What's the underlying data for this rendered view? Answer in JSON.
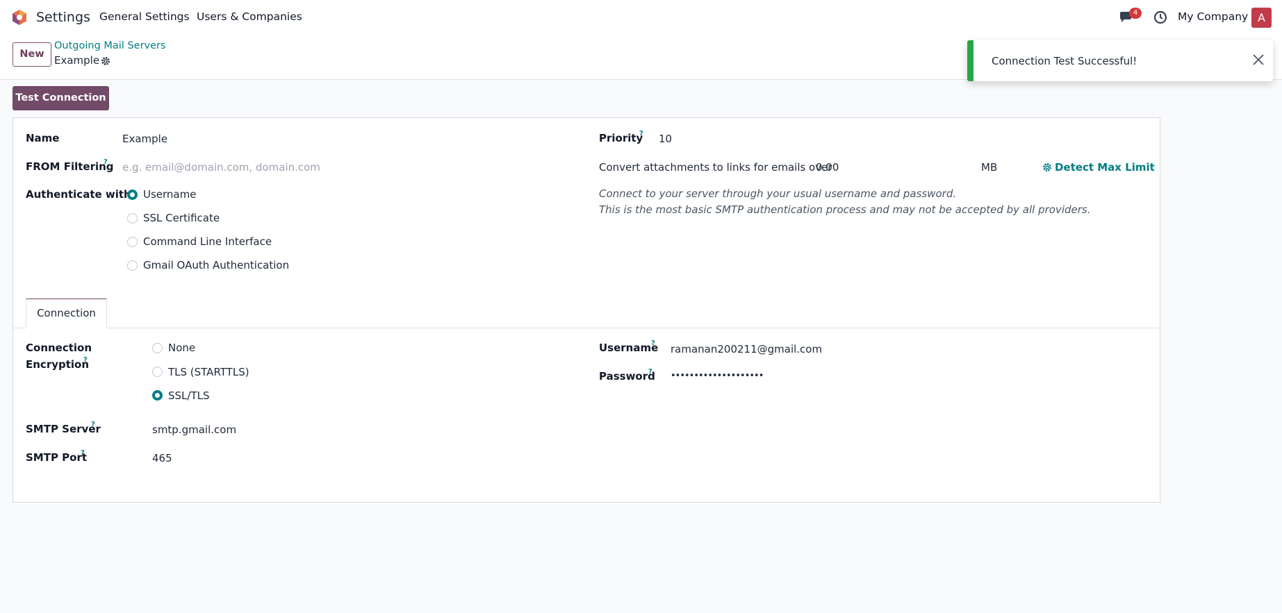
{
  "navbar": {
    "app_name": "Settings",
    "menu": [
      "General Settings",
      "Users & Companies"
    ],
    "chat_badge": "4",
    "company": "My Company",
    "avatar_letter": "A"
  },
  "control": {
    "new_label": "New",
    "breadcrumb_parent": "Outgoing Mail Servers",
    "breadcrumb_current": "Example"
  },
  "toast": {
    "message": "Connection Test Successful!",
    "color": "#28a745"
  },
  "actions": {
    "test_connection": "Test Connection"
  },
  "form": {
    "name_label": "Name",
    "name_value": "Example",
    "from_label": "FROM Filtering",
    "from_placeholder": "e.g. email@domain.com, domain.com",
    "auth_label": "Authenticate with",
    "auth_options": [
      "Username",
      "SSL Certificate",
      "Command Line Interface",
      "Gmail OAuth Authentication"
    ],
    "auth_selected": "Username",
    "priority_label": "Priority",
    "priority_value": "10",
    "attach_label": "Convert attachments to links for emails over",
    "attach_value": "0.00",
    "attach_unit": "MB",
    "detect_label": "Detect Max Limit",
    "auth_note_1": "Connect to your server through your usual username and password.",
    "auth_note_2": "This is the most basic SMTP authentication process and may not be accepted by all providers.",
    "help_mark": "?"
  },
  "tabs": {
    "connection": "Connection"
  },
  "connection": {
    "enc_label_1": "Connection",
    "enc_label_2": "Encryption",
    "enc_options": [
      "None",
      "TLS (STARTTLS)",
      "SSL/TLS"
    ],
    "enc_selected": "SSL/TLS",
    "smtp_server_label": "SMTP Server",
    "smtp_server_value": "smtp.gmail.com",
    "smtp_port_label": "SMTP Port",
    "smtp_port_value": "465",
    "username_label": "Username",
    "username_value": "ramanan200211@gmail.com",
    "password_label": "Password",
    "password_value": "••••••••••••••••••••"
  },
  "colors": {
    "brand": "#714b67",
    "link": "#017e84",
    "badge": "#d33a3a",
    "avatar": "#c13b4b"
  }
}
